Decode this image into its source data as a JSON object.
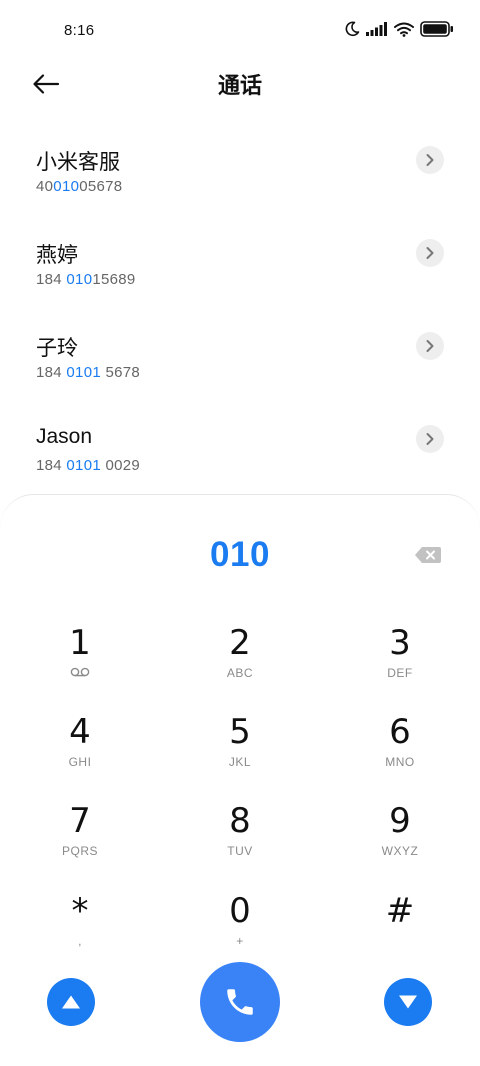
{
  "status_bar": {
    "time": "8:16",
    "icons": [
      "moon-icon",
      "signal-icon",
      "wifi-icon",
      "battery-icon"
    ]
  },
  "header": {
    "back_icon": "back-arrow-icon",
    "title": "通话"
  },
  "contacts": [
    {
      "name": "小米客服",
      "number_pre": "40",
      "number_match": "010",
      "number_post": "05678",
      "detail_icon": "chevron-right-icon"
    },
    {
      "name": "燕婷",
      "number_pre": "184 ",
      "number_match": "010",
      "number_post": "15689",
      "detail_icon": "chevron-right-icon"
    },
    {
      "name": "子玲",
      "number_pre": "184 ",
      "number_match": "0101",
      "number_post": " 5678",
      "detail_icon": "chevron-right-icon"
    },
    {
      "name": "Jason",
      "number_pre": "184 ",
      "number_match": "0101",
      "number_post": " 0029",
      "detail_icon": "chevron-right-icon"
    }
  ],
  "dialpad": {
    "input_value": "010",
    "backspace_icon": "backspace-icon",
    "keys": [
      {
        "digit": "1",
        "letters": "",
        "sub_icon": "voicemail-icon"
      },
      {
        "digit": "2",
        "letters": "ABC"
      },
      {
        "digit": "3",
        "letters": "DEF"
      },
      {
        "digit": "4",
        "letters": "GHI"
      },
      {
        "digit": "5",
        "letters": "JKL"
      },
      {
        "digit": "6",
        "letters": "MNO"
      },
      {
        "digit": "7",
        "letters": "PQRS"
      },
      {
        "digit": "8",
        "letters": "TUV"
      },
      {
        "digit": "9",
        "letters": "WXYZ"
      },
      {
        "digit": "*",
        "letters": ","
      },
      {
        "digit": "0",
        "letters": "+"
      },
      {
        "digit": "#",
        "letters": ""
      }
    ],
    "bottom": {
      "left_icon": "triangle-up-icon",
      "call_icon": "phone-icon",
      "right_icon": "triangle-down-icon"
    }
  },
  "colors": {
    "accent": "#1a7cf0",
    "call_button": "#3a83f7",
    "secondary_text": "#666666",
    "letters_text": "#8a8a8a"
  }
}
